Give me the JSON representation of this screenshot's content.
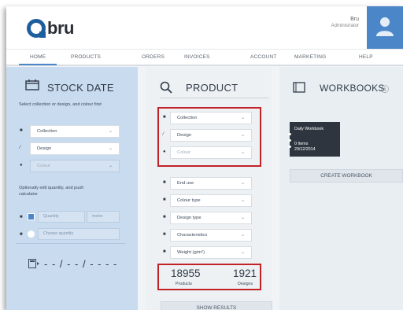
{
  "header": {
    "logo_text": "bru",
    "user_name": "Bru",
    "user_role": "Administrator"
  },
  "nav": {
    "items": [
      "HOME",
      "PRODUCTS",
      "ORDERS",
      "INVOICES",
      "ACCOUNT",
      "MARKETING",
      "HELP"
    ],
    "active": "HOME"
  },
  "stock_date": {
    "title": "STOCK DATE",
    "instruction": "Select collection or design, and colour first",
    "fields": [
      {
        "label": "Collection",
        "icon": "tag-icon"
      },
      {
        "label": "Design",
        "icon": "pencil-icon"
      },
      {
        "label": "Colour",
        "icon": "palette-icon"
      }
    ],
    "quantity_note_line1": "Optionally edit quantity, and push",
    "quantity_note_line2": "calculator",
    "quantity_placeholder": "Quantity",
    "metre_placeholder": "metre",
    "choose_quantity_placeholder": "Choose quantity",
    "date_display": "- - / - - / - - - -"
  },
  "product": {
    "title": "PRODUCT",
    "primary_filters": [
      {
        "label": "Collection",
        "dim": false
      },
      {
        "label": "Design",
        "dim": false
      },
      {
        "label": "Colour",
        "dim": true
      }
    ],
    "secondary_filters": [
      {
        "label": "End use"
      },
      {
        "label": "Colour type"
      },
      {
        "label": "Design type"
      },
      {
        "label": "Characteristics"
      },
      {
        "label": "Weight (g/m²)"
      }
    ],
    "products_count": "18955",
    "products_label": "Products",
    "designs_count": "1921",
    "designs_label": "Designs",
    "show_results_label": "SHOW RESULTS"
  },
  "workbooks": {
    "title": "WORKBOOKS",
    "card_title": "Daily Workbook",
    "card_items": "0 Items",
    "card_date": "29/12/2014",
    "create_label": "CREATE WORKBOOK"
  },
  "colors": {
    "accent_blue": "#4a86c8",
    "left_panel_bg": "#c9dbee",
    "highlight_red": "#c22227",
    "workbook_card_bg": "#2e353e"
  }
}
